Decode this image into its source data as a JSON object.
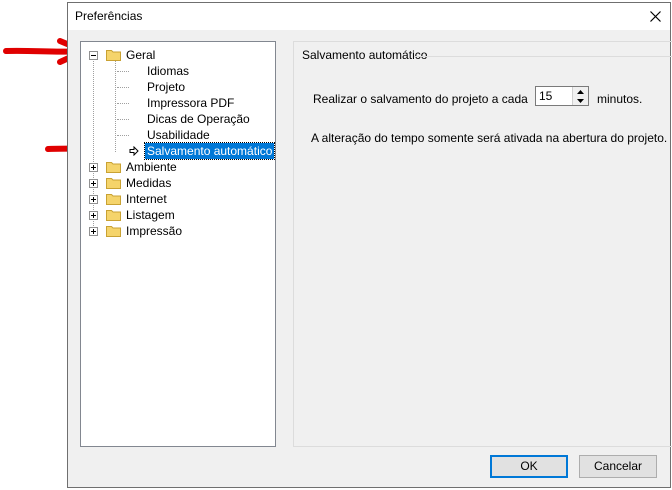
{
  "window": {
    "title": "Preferências"
  },
  "tree": {
    "geral": "Geral",
    "geral_children": [
      "Idiomas",
      "Projeto",
      "Impressora PDF",
      "Dicas de Operação",
      "Usabilidade",
      "Salvamento automático"
    ],
    "others": [
      "Ambiente",
      "Medidas",
      "Internet",
      "Listagem",
      "Impressão"
    ]
  },
  "panel": {
    "group_title": "Salvamento automático",
    "save_label": "Realizar o salvamento do projeto a cada",
    "interval_value": "15",
    "unit_label": "minutos.",
    "info": "A alteração do tempo somente será ativada na abertura do projeto."
  },
  "buttons": {
    "ok": "OK",
    "cancel": "Cancelar"
  },
  "colors": {
    "selection": "#0078d7",
    "arrow": "#e00000",
    "folder": "#f5d46b"
  }
}
